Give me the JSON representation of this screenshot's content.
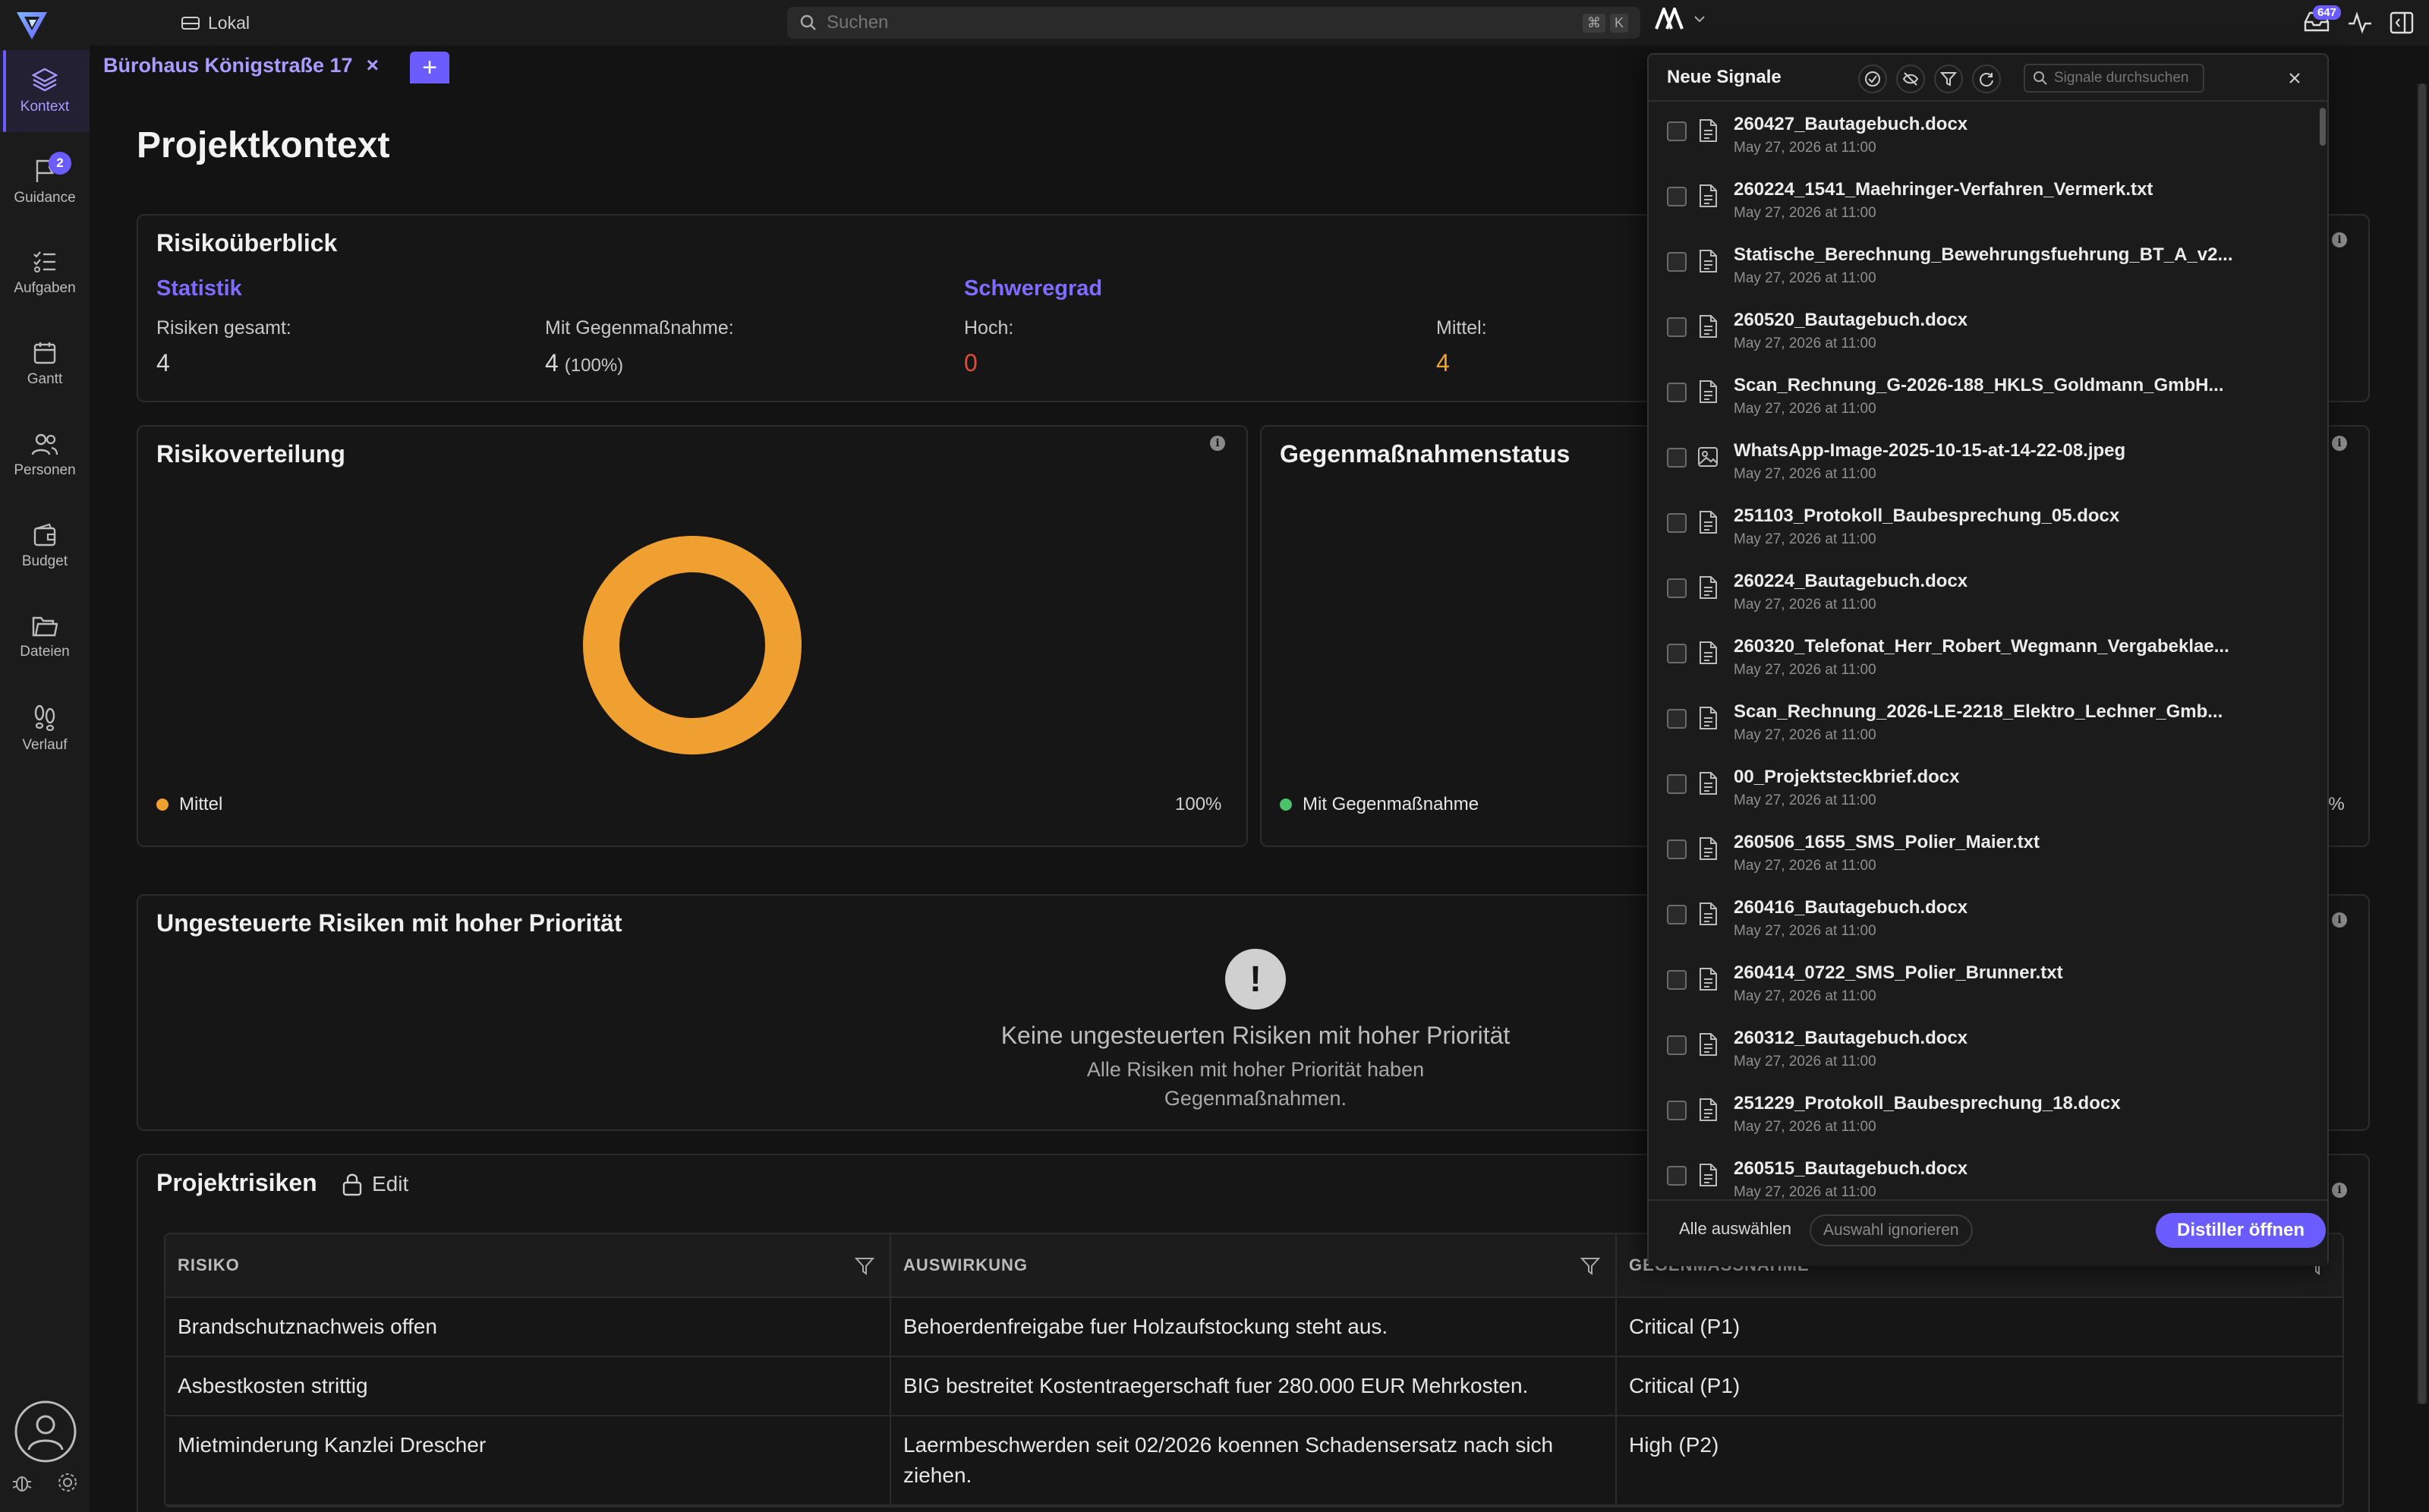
{
  "topbar": {
    "location": "Lokal",
    "search_placeholder": "Suchen",
    "shortcut_keys": [
      "⌘",
      "K"
    ],
    "notification_count": "647"
  },
  "sidebar": {
    "items": [
      {
        "label": "Kontext",
        "icon": "layers-icon",
        "active": true
      },
      {
        "label": "Guidance",
        "icon": "flag-icon",
        "badge": "2"
      },
      {
        "label": "Aufgaben",
        "icon": "checklist-icon"
      },
      {
        "label": "Gantt",
        "icon": "calendar-icon"
      },
      {
        "label": "Personen",
        "icon": "people-icon"
      },
      {
        "label": "Budget",
        "icon": "wallet-icon"
      },
      {
        "label": "Dateien",
        "icon": "folder-icon"
      },
      {
        "label": "Verlauf",
        "icon": "footsteps-icon"
      }
    ]
  },
  "tab": {
    "label": "Bürohaus Königstraße 17"
  },
  "page": {
    "title": "Projektkontext"
  },
  "risk_overview": {
    "title": "Risikoüberblick",
    "statistik_label": "Statistik",
    "schweregrad_label": "Schweregrad",
    "total_label": "Risiken gesamt:",
    "total_value": "4",
    "mitigated_label": "Mit Gegenmaßnahme:",
    "mitigated_value": "4",
    "mitigated_pct": "(100%)",
    "hoch_label": "Hoch:",
    "hoch_value": "0",
    "mittel_label": "Mittel:",
    "mittel_value": "4"
  },
  "distribution": {
    "title": "Risikoverteilung",
    "legend_label": "Mittel",
    "legend_pct": "100%",
    "color": "#f0a030"
  },
  "countermeasures": {
    "title": "Gegenmaßnahmenstatus",
    "legend_label": "Mit Gegenmaßnahme",
    "legend_pct": "0%",
    "color": "#4cc36a"
  },
  "unmanaged": {
    "title": "Ungesteuerte Risiken mit hoher Priorität",
    "empty_title": "Keine ungesteuerten Risiken mit hoher Priorität",
    "empty_line1": "Alle Risiken mit hoher Priorität haben",
    "empty_line2": "Gegenmaßnahmen."
  },
  "risks": {
    "title": "Projektrisiken",
    "edit_label": "Edit",
    "columns": [
      "RISIKO",
      "AUSWIRKUNG",
      "GEGENMASSNAHME"
    ],
    "rows": [
      [
        "Brandschutznachweis offen",
        "Behoerdenfreigabe fuer Holzaufstockung steht aus.",
        "Critical (P1)"
      ],
      [
        "Asbestkosten strittig",
        "BIG bestreitet Kostentraegerschaft fuer 280.000 EUR Mehrkosten.",
        "Critical (P1)"
      ],
      [
        "Mietminderung Kanzlei Drescher",
        "Laermbeschwerden seit 02/2026 koennen Schadensersatz nach sich ziehen.",
        "High (P2)"
      ]
    ]
  },
  "signals": {
    "title": "Neue Signale",
    "search_placeholder": "Signale durchsuchen",
    "select_all": "Alle auswählen",
    "ignore_selection": "Auswahl ignorieren",
    "open_distiller": "Distiller öffnen",
    "items": [
      {
        "name": "260427_Bautagebuch.docx",
        "date": "May 27, 2026 at 11:00",
        "kind": "document-icon"
      },
      {
        "name": "260224_1541_Maehringer-Verfahren_Vermerk.txt",
        "date": "May 27, 2026 at 11:00",
        "kind": "document-icon"
      },
      {
        "name": "Statische_Berechnung_Bewehrungsfuehrung_BT_A_v2...",
        "date": "May 27, 2026 at 11:00",
        "kind": "document-icon"
      },
      {
        "name": "260520_Bautagebuch.docx",
        "date": "May 27, 2026 at 11:00",
        "kind": "document-icon"
      },
      {
        "name": "Scan_Rechnung_G-2026-188_HKLS_Goldmann_GmbH...",
        "date": "May 27, 2026 at 11:00",
        "kind": "document-icon"
      },
      {
        "name": "WhatsApp-Image-2025-10-15-at-14-22-08.jpeg",
        "date": "May 27, 2026 at 11:00",
        "kind": "image-icon"
      },
      {
        "name": "251103_Protokoll_Baubesprechung_05.docx",
        "date": "May 27, 2026 at 11:00",
        "kind": "document-icon"
      },
      {
        "name": "260224_Bautagebuch.docx",
        "date": "May 27, 2026 at 11:00",
        "kind": "document-icon"
      },
      {
        "name": "260320_Telefonat_Herr_Robert_Wegmann_Vergabeklae...",
        "date": "May 27, 2026 at 11:00",
        "kind": "document-icon"
      },
      {
        "name": "Scan_Rechnung_2026-LE-2218_Elektro_Lechner_Gmb...",
        "date": "May 27, 2026 at 11:00",
        "kind": "document-icon"
      },
      {
        "name": "00_Projektsteckbrief.docx",
        "date": "May 27, 2026 at 11:00",
        "kind": "document-icon"
      },
      {
        "name": "260506_1655_SMS_Polier_Maier.txt",
        "date": "May 27, 2026 at 11:00",
        "kind": "document-icon"
      },
      {
        "name": "260416_Bautagebuch.docx",
        "date": "May 27, 2026 at 11:00",
        "kind": "document-icon"
      },
      {
        "name": "260414_0722_SMS_Polier_Brunner.txt",
        "date": "May 27, 2026 at 11:00",
        "kind": "document-icon"
      },
      {
        "name": "260312_Bautagebuch.docx",
        "date": "May 27, 2026 at 11:00",
        "kind": "document-icon"
      },
      {
        "name": "251229_Protokoll_Baubesprechung_18.docx",
        "date": "May 27, 2026 at 11:00",
        "kind": "document-icon"
      },
      {
        "name": "260515_Bautagebuch.docx",
        "date": "May 27, 2026 at 11:00",
        "kind": "document-icon"
      }
    ]
  },
  "colors": {
    "accent": "#6b5cff",
    "danger": "#e04a3a",
    "warning": "#f0a030"
  }
}
